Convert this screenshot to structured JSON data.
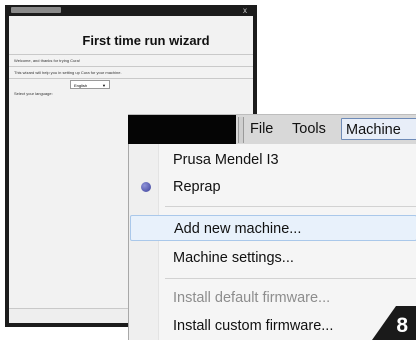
{
  "wizard": {
    "close_label": "x",
    "heading": "First time run wizard",
    "welcome": "Welcome, and thanks for trying Cura!",
    "intro": "This wizard will help you in setting up Cura for your machine.",
    "language_label": "Select your language:",
    "language_value": "English"
  },
  "menubar": {
    "items": [
      "File",
      "Tools",
      "Machine"
    ]
  },
  "machine_menu": {
    "items": [
      {
        "label": "Prusa Mendel I3",
        "disabled": false
      },
      {
        "label": "Reprap",
        "disabled": false,
        "selected": true
      },
      {
        "label": "Add new machine...",
        "disabled": false,
        "highlighted": true
      },
      {
        "label": "Machine settings...",
        "disabled": false
      },
      {
        "label": "Install default firmware...",
        "disabled": true
      },
      {
        "label": "Install custom firmware...",
        "disabled": false
      }
    ]
  },
  "step_number": "8",
  "colors": {
    "highlight_bg": "#e8f1fb",
    "highlight_border": "#aac8ea",
    "badge": "#1a1a1a"
  }
}
